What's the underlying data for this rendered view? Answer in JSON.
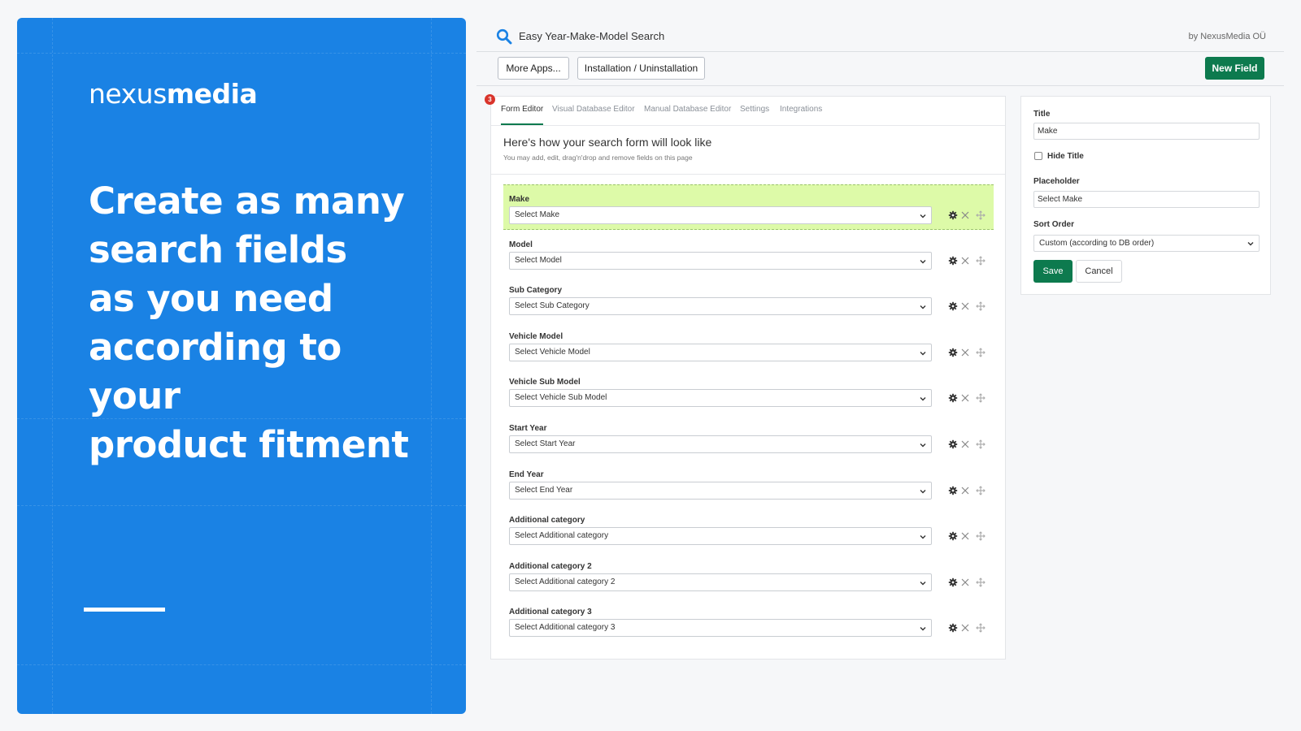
{
  "hero": {
    "logo_light": "nexus",
    "logo_bold": "media",
    "headline_lines": [
      "Create as many",
      "search fields",
      "as you need",
      "according to your",
      "product fitment"
    ]
  },
  "app": {
    "title": "Easy Year-Make-Model Search",
    "by": "by NexusMedia OÜ",
    "more_apps_label": "More Apps...",
    "install_label": "Installation / Uninstallation",
    "new_field_label": "New Field"
  },
  "editor": {
    "badge_count": "3",
    "tabs": [
      {
        "label": "Form Editor",
        "active": true
      },
      {
        "label": "Visual Database Editor",
        "active": false
      },
      {
        "label": "Manual Database Editor",
        "active": false
      },
      {
        "label": "Settings",
        "active": false
      },
      {
        "label": "Integrations",
        "active": false
      }
    ],
    "heading": "Here's how your search form will look like",
    "subheading": "You may add, edit, drag'n'drop and remove fields on this page",
    "fields": [
      {
        "label": "Make",
        "placeholder": "Select Make",
        "selected": true
      },
      {
        "label": "Model",
        "placeholder": "Select Model",
        "selected": false
      },
      {
        "label": "Sub Category",
        "placeholder": "Select Sub Category",
        "selected": false
      },
      {
        "label": "Vehicle Model",
        "placeholder": "Select Vehicle Model",
        "selected": false
      },
      {
        "label": "Vehicle Sub Model",
        "placeholder": "Select Vehicle Sub Model",
        "selected": false
      },
      {
        "label": "Start Year",
        "placeholder": "Select Start Year",
        "selected": false
      },
      {
        "label": "End Year",
        "placeholder": "Select End Year",
        "selected": false
      },
      {
        "label": "Additional category",
        "placeholder": "Select Additional category",
        "selected": false
      },
      {
        "label": "Additional category 2",
        "placeholder": "Select Additional category 2",
        "selected": false
      },
      {
        "label": "Additional category 3",
        "placeholder": "Select Additional category 3",
        "selected": false
      }
    ]
  },
  "props": {
    "title_label": "Title",
    "title_value": "Make",
    "hide_title_label": "Hide Title",
    "hide_title_checked": false,
    "placeholder_label": "Placeholder",
    "placeholder_value": "Select Make",
    "sort_order_label": "Sort Order",
    "sort_order_value": "Custom (according to DB order)",
    "save_label": "Save",
    "cancel_label": "Cancel"
  },
  "colors": {
    "hero_blue": "#1a82e4",
    "brand_green": "#0d7a4e",
    "selected_row": "#ddfaa8",
    "badge_red": "#d9342b"
  },
  "icons": [
    "search-icon",
    "chevron-down-icon",
    "gear-icon",
    "close-icon",
    "move-icon"
  ]
}
